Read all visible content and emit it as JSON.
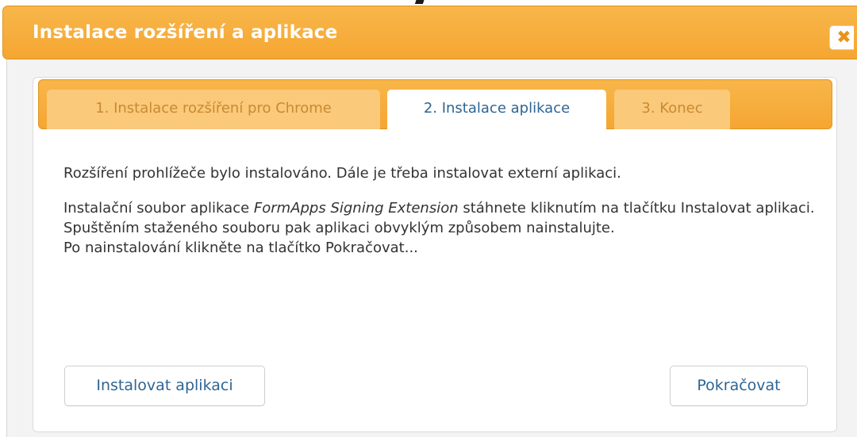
{
  "dialog": {
    "title": "Instalace rozšíření a aplikace",
    "close_icon": "close-icon",
    "close_glyph": "✖",
    "accent_color": "#f5a632",
    "link_color": "#2e6593"
  },
  "tabs": [
    {
      "label": "1. Instalace rozšíření pro Chrome",
      "state": "inactive"
    },
    {
      "label": "2. Instalace aplikace",
      "state": "active"
    },
    {
      "label": "3. Konec",
      "state": "inactive"
    }
  ],
  "content": {
    "paragraph1": "Rozšíření prohlížeče bylo instalováno. Dále je třeba instalovat externí aplikaci.",
    "paragraph2_prefix": "Instalační soubor aplikace ",
    "paragraph2_app_name": "FormApps Signing Extension",
    "paragraph2_suffix": " stáhnete kliknutím na tlačítku Instalovat aplikaci. Spuštěním staženého souboru pak aplikaci obvyklým způsobem nainstalujte.",
    "paragraph3": "Po nainstalování klikněte na tlačítko Pokračovat..."
  },
  "buttons": {
    "install_label": "Instalovat aplikaci",
    "continue_label": "Pokračovat"
  }
}
